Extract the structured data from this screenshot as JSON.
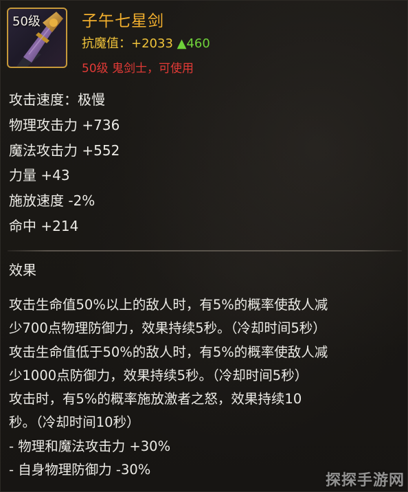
{
  "item": {
    "level_badge": "50级",
    "name": "子午七星剑",
    "resist_label": "抗魔值：",
    "resist_value": "+2033",
    "resist_delta": "▲460",
    "requirement": "50级 鬼剑士，可使用"
  },
  "stats": [
    "攻击速度：极慢",
    "物理攻击力 +736",
    "魔法攻击力 +552",
    "力量 +43",
    "施放速度 -2%",
    "命中 +214"
  ],
  "effect": {
    "title": "效果",
    "lines": [
      "攻击生命值50%以上的敌人时，有5%的概率使敌人减",
      "少700点物理防御力，效果持续5秒。（冷却时间5秒）",
      "攻击生命值低于50%的敌人时，有5%的概率使敌人减",
      "少1000点防御力，效果持续5秒。（冷却时间5秒）",
      "攻击时，有5%的概率施放激者之怒，效果持续10",
      "秒。（冷却时间10秒）",
      " - 物理和魔法攻击力 +30%",
      " - 自身物理防御力 -30%"
    ]
  },
  "watermark": "探探手游网",
  "icon": "sword-icon",
  "colors": {
    "name": "#f3b02e",
    "resist": "#f0c33a",
    "delta": "#6fd23a",
    "requirement": "#e23a36",
    "text": "#ecebe6",
    "frame": "#c79a3a"
  }
}
